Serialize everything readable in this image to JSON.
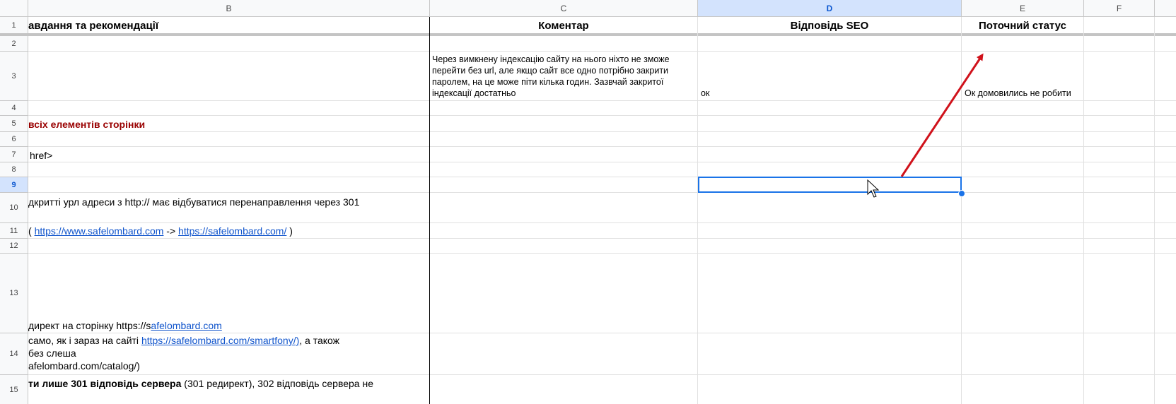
{
  "columns": [
    "B",
    "C",
    "D",
    "E",
    "F"
  ],
  "rows": [
    "1",
    "2",
    "3",
    "4",
    "5",
    "6",
    "7",
    "8",
    "9",
    "10",
    "11",
    "12",
    "13",
    "14",
    "15"
  ],
  "header": {
    "b": "авдання та рекомендації",
    "c": "Коментар",
    "d": "Відповідь SEO",
    "e": "Поточний статус"
  },
  "cells": {
    "c3": "Через вимкнену індексацію сайту на нього ніхто не зможе перейти без url, але якщо сайт все одно потрібно закрити паролем, на це може піти кілька годин. Зазвчай закритої індексації достатньо",
    "d3": "ок",
    "e3": "Ок домовились не робити",
    "b5": "всіх елементів сторінки",
    "b7": " href>",
    "b10": "дкритті урл адреси з http:// має відбуватися перенаправлення через 301",
    "b11_prefix": "( ",
    "b11_link1": "https://www.safelombard.com",
    "b11_mid": " -> ",
    "b11_link2": "https://safelombard.com/",
    "b11_suffix": " )",
    "b13_prefix": "директ на сторінку https://s",
    "b13_link": "afelombard.com",
    "b14_line1_prefix": "само, як і зараз на сайті ",
    "b14_line1_link": "https://safelombard.com/smartfony/)",
    "b14_line1_suffix": ", а також",
    "b14_line2": " без слеша",
    "b14_line3": "afelombard.com/catalog/)",
    "b15_bold": "ти лише 301 відповідь сервера",
    "b15_rest": " (301 редирект), 302 відповідь сервера не"
  },
  "selected_cell": "D9",
  "colors": {
    "selection": "#1a73e8",
    "arrow": "#d0121b",
    "red_text": "#990000",
    "link": "#1155cc"
  }
}
